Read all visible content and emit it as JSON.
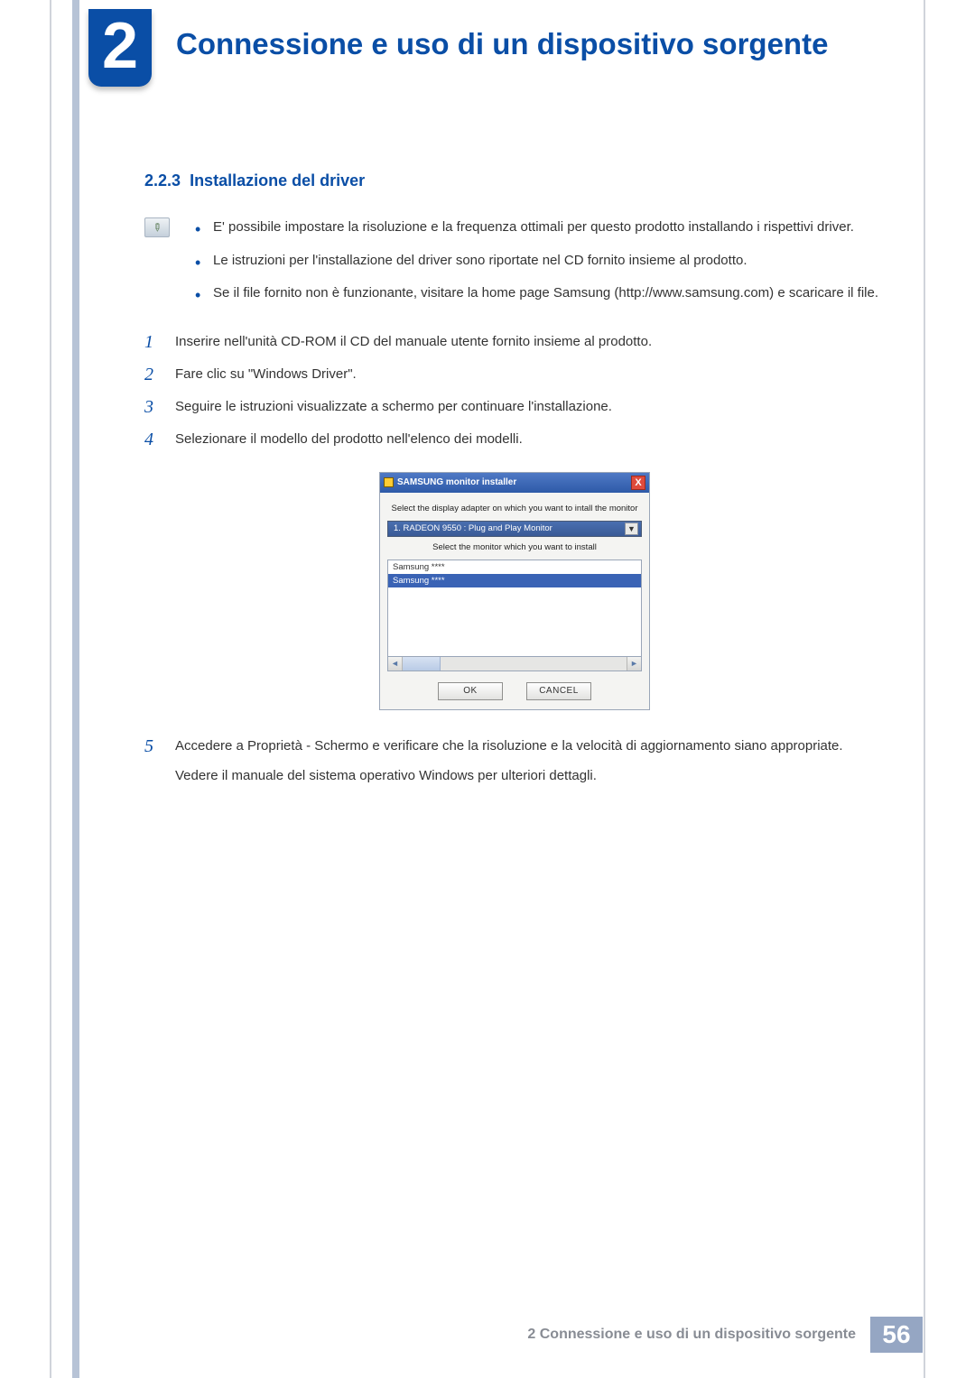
{
  "chapter": {
    "number": "2",
    "title": "Connessione e uso di un dispositivo sorgente"
  },
  "section": {
    "number": "2.2.3",
    "title": "Installazione del driver"
  },
  "notes": [
    "E' possibile impostare la risoluzione e la frequenza ottimali per questo prodotto installando i rispettivi driver.",
    "Le istruzioni per l'installazione del driver sono riportate nel CD fornito insieme al prodotto.",
    "Se il file fornito non è funzionante, visitare la home page Samsung (http://www.samsung.com) e scaricare il file."
  ],
  "steps": [
    {
      "num": "1",
      "text": "Inserire nell'unità CD-ROM il CD del manuale utente fornito insieme al prodotto."
    },
    {
      "num": "2",
      "text": "Fare clic su \"Windows Driver\"."
    },
    {
      "num": "3",
      "text": "Seguire le istruzioni visualizzate a schermo per continuare l'installazione."
    },
    {
      "num": "4",
      "text": "Selezionare il modello del prodotto nell'elenco dei modelli."
    },
    {
      "num": "5",
      "text": "Accedere a Proprietà - Schermo e verificare che la risoluzione e la velocità di aggiornamento siano appropriate.",
      "extra": "Vedere il manuale del sistema operativo Windows per ulteriori dettagli."
    }
  ],
  "installer": {
    "title": "SAMSUNG monitor installer",
    "close": "X",
    "label_adapter": "Select the display adapter on which you want to intall the monitor",
    "combo_value": "1. RADEON 9550 : Plug and Play Monitor",
    "label_monitor": "Select the monitor which you want to install",
    "list_item_1": "Samsung ****",
    "list_item_2": "Samsung ****",
    "ok": "OK",
    "cancel": "CANCEL"
  },
  "footer": {
    "text": "2 Connessione e uso di un dispositivo sorgente",
    "page": "56"
  }
}
